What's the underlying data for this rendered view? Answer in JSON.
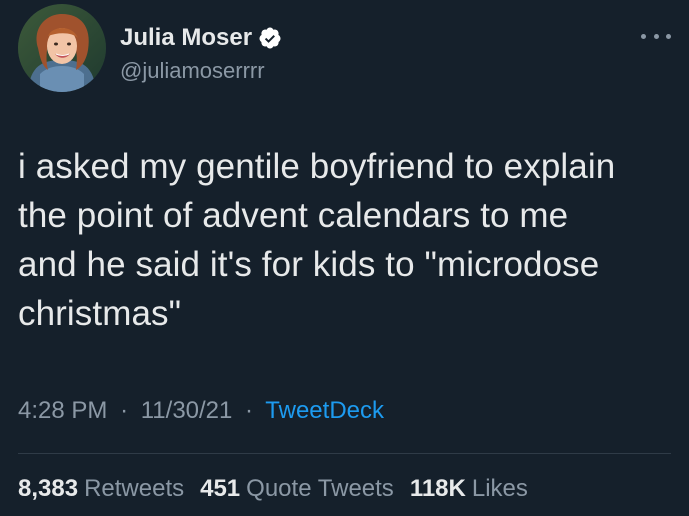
{
  "author": {
    "display_name": "Julia Moser",
    "handle": "@juliamoserrrr",
    "verified_icon": "verified-badge-icon",
    "avatar_icon": "avatar"
  },
  "tweet": {
    "text": "i asked my gentile boyfriend to explain\nthe point of advent calendars to me\nand he said it's for kids to \"microdose\nchristmas\""
  },
  "meta": {
    "time": "4:28 PM",
    "separator": "·",
    "date": "11/30/21",
    "source": "TweetDeck"
  },
  "stats": {
    "retweets_value": "8,383",
    "retweets_label": "Retweets",
    "quotes_value": "451",
    "quotes_label": "Quote Tweets",
    "likes_value": "118K",
    "likes_label": "Likes"
  },
  "colors": {
    "background": "#15202b",
    "primary_text": "#e7e9ea",
    "secondary_text": "#8b98a5",
    "accent": "#1d9bf0",
    "divider": "#2f3b47"
  }
}
